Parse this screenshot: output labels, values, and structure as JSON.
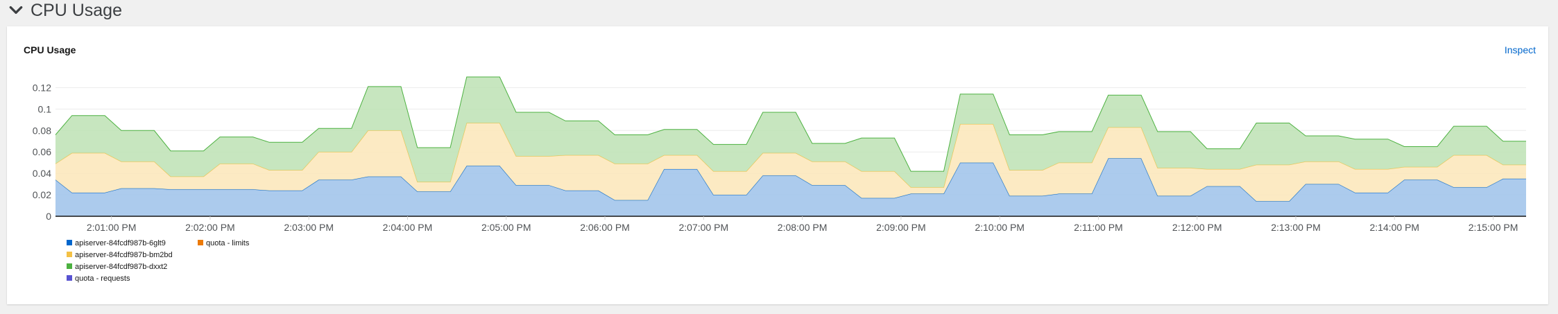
{
  "section": {
    "title": "CPU Usage"
  },
  "card": {
    "title": "CPU Usage",
    "inspect_label": "Inspect"
  },
  "icons": {
    "collapse": "chevron-down-icon"
  },
  "colors": {
    "apiserver-84fcdf987b-6glt9": "#0066cc",
    "apiserver-84fcdf987b-bm2bd": "#f4c145",
    "apiserver-84fcdf987b-dxxt2": "#4cb140",
    "quota - limits": "#ec7a08",
    "quota - requests": "#5752d1"
  },
  "chart_data": {
    "type": "area",
    "stacked": true,
    "title": "CPU Usage",
    "x_tick_labels": [
      "2:01:00 PM",
      "2:02:00 PM",
      "2:03:00 PM",
      "2:04:00 PM",
      "2:05:00 PM",
      "2:06:00 PM",
      "2:07:00 PM",
      "2:08:00 PM",
      "2:09:00 PM",
      "2:10:00 PM",
      "2:11:00 PM",
      "2:12:00 PM",
      "2:13:00 PM",
      "2:14:00 PM",
      "2:15:00 PM"
    ],
    "y_tick_labels": [
      "0",
      "0.02",
      "0.04",
      "0.06",
      "0.08",
      "0.1",
      "0.12"
    ],
    "ylim": [
      0,
      0.13
    ],
    "grid": true,
    "legend_position": "bottom-left",
    "x": [
      "2:00:26 PM",
      "2:00:36 PM",
      "2:00:56 PM",
      "2:01:06 PM",
      "2:01:26 PM",
      "2:01:36 PM",
      "2:01:56 PM",
      "2:02:06 PM",
      "2:02:26 PM",
      "2:02:36 PM",
      "2:02:56 PM",
      "2:03:06 PM",
      "2:03:26 PM",
      "2:03:36 PM",
      "2:03:56 PM",
      "2:04:06 PM",
      "2:04:26 PM",
      "2:04:36 PM",
      "2:04:56 PM",
      "2:05:06 PM",
      "2:05:26 PM",
      "2:05:36 PM",
      "2:05:56 PM",
      "2:06:06 PM",
      "2:06:26 PM",
      "2:06:36 PM",
      "2:06:56 PM",
      "2:07:06 PM",
      "2:07:26 PM",
      "2:07:36 PM",
      "2:07:56 PM",
      "2:08:06 PM",
      "2:08:26 PM",
      "2:08:36 PM",
      "2:08:56 PM",
      "2:09:06 PM",
      "2:09:26 PM",
      "2:09:36 PM",
      "2:09:56 PM",
      "2:10:06 PM",
      "2:10:26 PM",
      "2:10:36 PM",
      "2:10:56 PM",
      "2:11:06 PM",
      "2:11:26 PM",
      "2:11:36 PM",
      "2:11:56 PM",
      "2:12:06 PM",
      "2:12:26 PM",
      "2:12:36 PM",
      "2:12:56 PM",
      "2:13:06 PM",
      "2:13:26 PM",
      "2:13:36 PM",
      "2:13:56 PM",
      "2:14:06 PM",
      "2:14:26 PM",
      "2:14:36 PM",
      "2:14:56 PM",
      "2:15:06 PM",
      "2:15:20 PM"
    ],
    "series": [
      {
        "name": "apiserver-84fcdf987b-6glt9",
        "values": [
          0.034,
          0.022,
          0.022,
          0.026,
          0.026,
          0.025,
          0.025,
          0.025,
          0.025,
          0.024,
          0.024,
          0.034,
          0.034,
          0.037,
          0.037,
          0.023,
          0.023,
          0.047,
          0.047,
          0.029,
          0.029,
          0.024,
          0.024,
          0.015,
          0.015,
          0.044,
          0.044,
          0.02,
          0.02,
          0.038,
          0.038,
          0.029,
          0.029,
          0.017,
          0.017,
          0.021,
          0.021,
          0.05,
          0.05,
          0.019,
          0.019,
          0.021,
          0.021,
          0.054,
          0.054,
          0.019,
          0.019,
          0.028,
          0.028,
          0.014,
          0.014,
          0.03,
          0.03,
          0.022,
          0.022,
          0.034,
          0.034,
          0.027,
          0.027,
          0.035,
          0.035
        ]
      },
      {
        "name": "apiserver-84fcdf987b-bm2bd",
        "values": [
          0.015,
          0.037,
          0.037,
          0.025,
          0.025,
          0.012,
          0.012,
          0.024,
          0.024,
          0.019,
          0.019,
          0.026,
          0.026,
          0.043,
          0.043,
          0.009,
          0.009,
          0.04,
          0.04,
          0.027,
          0.027,
          0.033,
          0.033,
          0.034,
          0.034,
          0.013,
          0.013,
          0.022,
          0.022,
          0.021,
          0.021,
          0.022,
          0.022,
          0.025,
          0.025,
          0.006,
          0.006,
          0.036,
          0.036,
          0.024,
          0.024,
          0.029,
          0.029,
          0.029,
          0.029,
          0.026,
          0.026,
          0.016,
          0.016,
          0.034,
          0.034,
          0.021,
          0.021,
          0.022,
          0.022,
          0.012,
          0.012,
          0.03,
          0.03,
          0.013,
          0.013
        ]
      },
      {
        "name": "apiserver-84fcdf987b-dxxt2",
        "values": [
          0.027,
          0.035,
          0.035,
          0.029,
          0.029,
          0.024,
          0.024,
          0.025,
          0.025,
          0.026,
          0.026,
          0.022,
          0.022,
          0.041,
          0.041,
          0.032,
          0.032,
          0.043,
          0.043,
          0.041,
          0.041,
          0.032,
          0.032,
          0.027,
          0.027,
          0.024,
          0.024,
          0.025,
          0.025,
          0.038,
          0.038,
          0.017,
          0.017,
          0.031,
          0.031,
          0.015,
          0.015,
          0.028,
          0.028,
          0.033,
          0.033,
          0.029,
          0.029,
          0.03,
          0.03,
          0.034,
          0.034,
          0.019,
          0.019,
          0.039,
          0.039,
          0.024,
          0.024,
          0.028,
          0.028,
          0.019,
          0.019,
          0.027,
          0.027,
          0.022,
          0.022
        ]
      }
    ],
    "legend": [
      {
        "name": "apiserver-84fcdf987b-6glt9",
        "color": "#0066cc"
      },
      {
        "name": "apiserver-84fcdf987b-bm2bd",
        "color": "#f4c145"
      },
      {
        "name": "apiserver-84fcdf987b-dxxt2",
        "color": "#4cb140"
      },
      {
        "name": "quota - requests",
        "color": "#5752d1"
      },
      {
        "name": "quota - limits",
        "color": "#ec7a08"
      }
    ]
  }
}
